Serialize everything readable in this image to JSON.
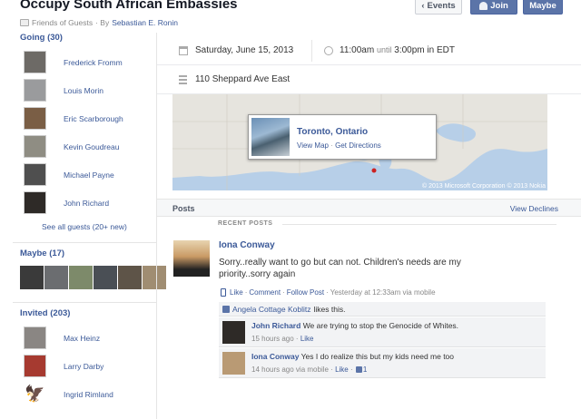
{
  "event": {
    "title": "Occupy South African Embassies",
    "group": "Friends of Guests",
    "by_prefix": "· By",
    "host": "Sebastian E. Ronin"
  },
  "buttons": {
    "events": "Events",
    "join": "Join",
    "maybe": "Maybe"
  },
  "sidebar": {
    "going": {
      "title": "Going (30)",
      "people": [
        {
          "name": "Frederick Fromm",
          "color": "#6d6a66"
        },
        {
          "name": "Louis Morin",
          "color": "#9a9b9d"
        },
        {
          "name": "Eric Scarborough",
          "color": "#7a5e45"
        },
        {
          "name": "Kevin Goudreau",
          "color": "#8f8d83"
        },
        {
          "name": "Michael Payne",
          "color": "#4f4f4f"
        },
        {
          "name": "John Richard",
          "color": "#2e2a27"
        }
      ],
      "see_all": "See all guests (20+ new)"
    },
    "maybe": {
      "title": "Maybe (17)",
      "avatars": [
        "#3a3a3a",
        "#6b6d70",
        "#7d8a6a",
        "#4a4f55",
        "#5e5448",
        "#a08d72"
      ]
    },
    "invited": {
      "title": "Invited (203)",
      "people": [
        {
          "name": "Max Heinz",
          "color": "#8a8683"
        },
        {
          "name": "Larry Darby",
          "color": "#a63a30"
        },
        {
          "name": "Ingrid Rimland",
          "color": "#c0803a"
        }
      ]
    }
  },
  "details": {
    "date": "Saturday, June 15, 2013",
    "time_start": "11:00am",
    "time_until": "until",
    "time_end": "3:00pm in EDT",
    "address": "110 Sheppard Ave East"
  },
  "map": {
    "city": "Toronto, Ontario",
    "view_map": "View Map",
    "directions": "Get Directions",
    "copyright": "© 2013 Microsoft Corporation © 2013 Nokia"
  },
  "posts": {
    "title": "Posts",
    "view_declines": "View Declines",
    "recent": "RECENT POSTS",
    "post": {
      "author": "Iona Conway",
      "text": "Sorry..really want to go but can not. Children's needs are my priority..sorry again",
      "like": "Like",
      "comment": "Comment",
      "follow": "Follow Post",
      "time": "Yesterday at 12:33am via mobile",
      "likes_name": "Angela Cottage Koblitz",
      "likes_suffix": "likes this.",
      "comments": [
        {
          "author": "John Richard",
          "text": "We are trying to stop the Genocide of Whites.",
          "time": "15 hours ago",
          "like": "Like",
          "color": "#2e2a27"
        },
        {
          "author": "Iona Conway",
          "text": "Yes I do realize this but my kids need me too",
          "time": "14 hours ago via mobile",
          "like": "Like",
          "likes": "1",
          "color": "#b99a74"
        }
      ]
    }
  }
}
